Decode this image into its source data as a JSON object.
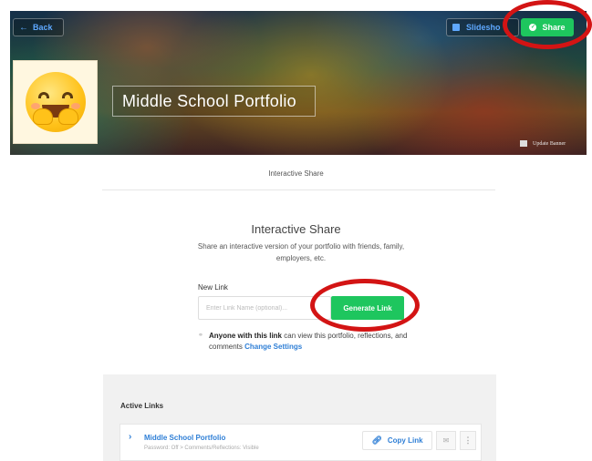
{
  "header": {
    "back_label": "Back",
    "slideshow_label": "Slidesho",
    "share_label": "Share",
    "portfolio_title": "Middle School Portfolio",
    "update_banner_label": "Update Banner"
  },
  "tab": {
    "title": "Interactive Share"
  },
  "share_section": {
    "title": "Interactive Share",
    "description": "Share an interactive version of your portfolio with friends, family, employers, etc.",
    "new_link_label": "New Link",
    "input_placeholder": "Enter Link Name (optional)...",
    "generate_label": "Generate Link",
    "perm_bold": "Anyone with this link",
    "perm_text": " can view this portfolio, reflections, and comments ",
    "change_settings": "Change Settings"
  },
  "active_links": {
    "title": "Active Links",
    "items": [
      {
        "name": "Middle School Portfolio",
        "meta": "Password: Off  >  Comments/Reflections: Visible",
        "copy_label": "Copy Link"
      }
    ]
  },
  "colors": {
    "accent_green": "#1ec65e",
    "link_blue": "#2f7fd6",
    "highlight_red": "#d31414"
  }
}
